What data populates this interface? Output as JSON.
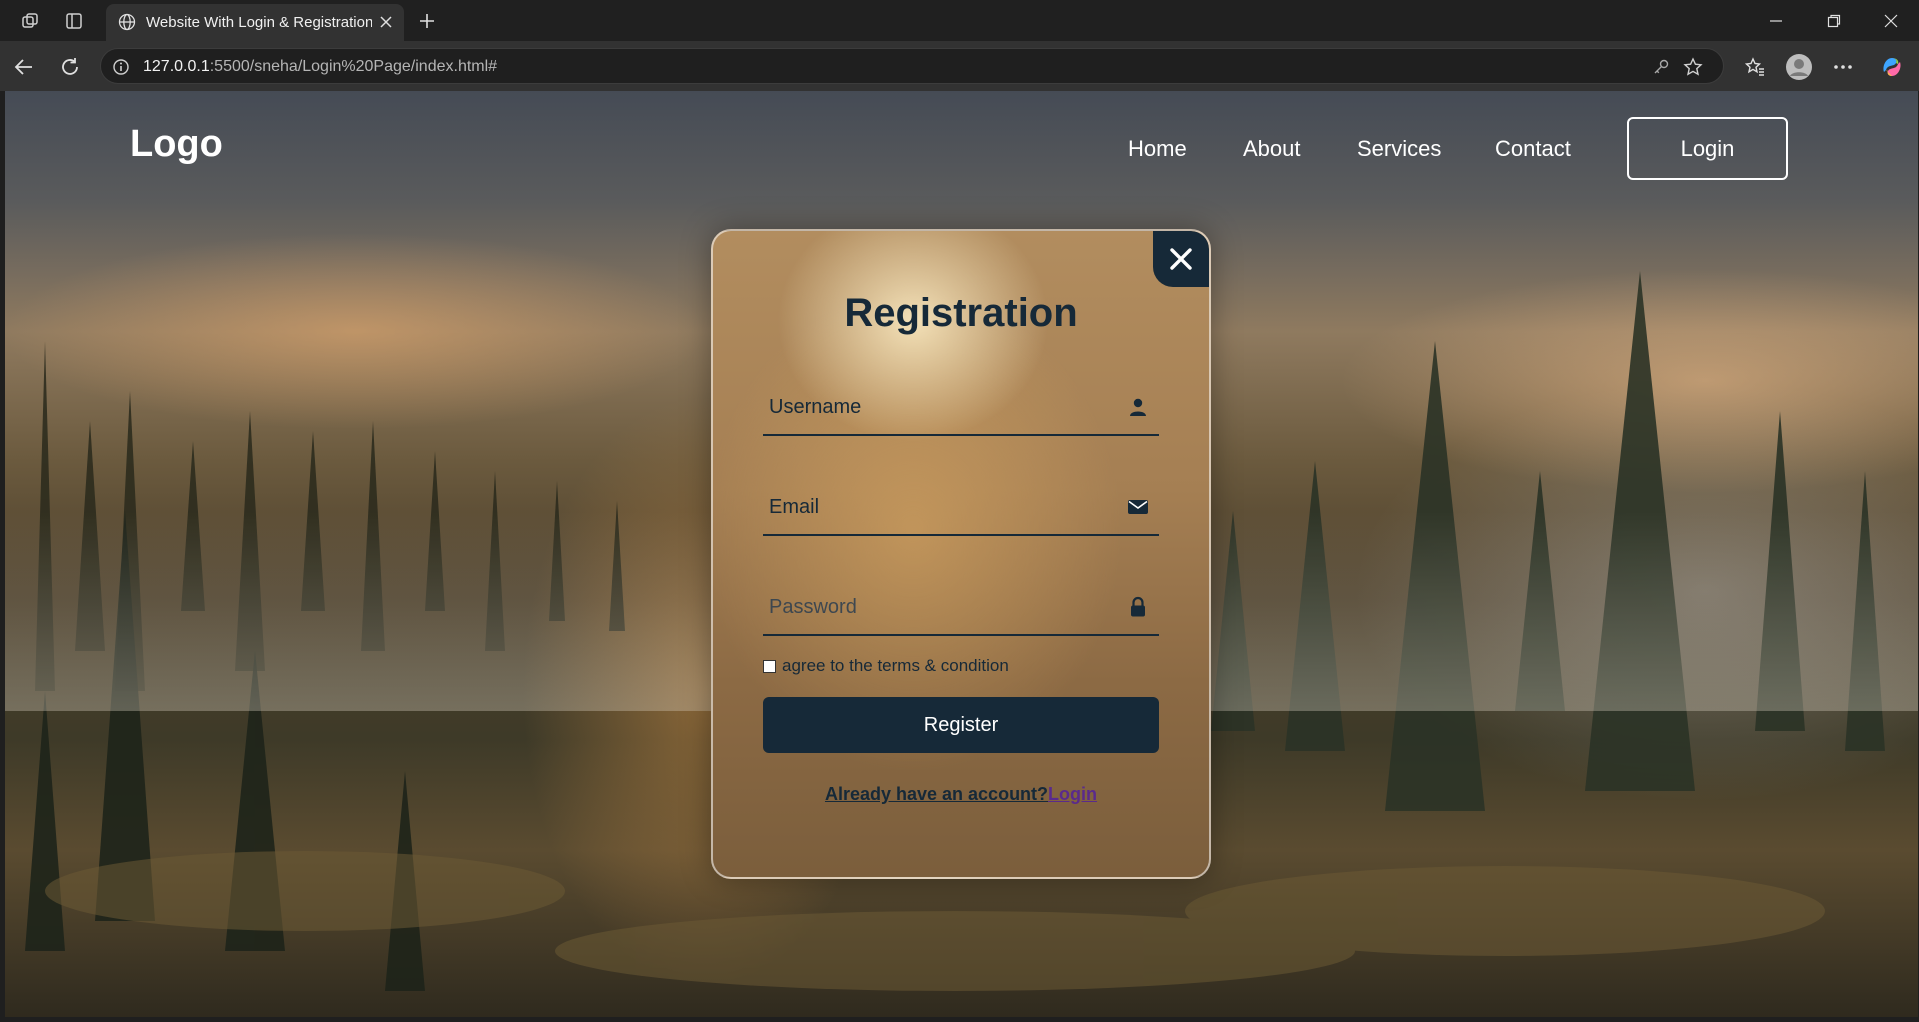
{
  "browser": {
    "tab_title": "Website With Login & Registration",
    "url_host": "127.0.0.1",
    "url_rest": ":5500/sneha/Login%20Page/index.html#"
  },
  "page": {
    "logo": "Logo",
    "nav": [
      "Home",
      "About",
      "Services",
      "Contact"
    ],
    "login_button": "Login"
  },
  "form": {
    "title": "Registration",
    "username_placeholder": "Username",
    "email_placeholder": "Email",
    "password_placeholder": "Password",
    "terms_label": "agree to the terms & condition",
    "register_button": "Register",
    "switch_text": "Already have an account?",
    "switch_link": "Login"
  },
  "colors": {
    "primary": "#162938",
    "link": "#5a2a8c",
    "chrome_dark": "#202020",
    "chrome_toolbar": "#323232"
  }
}
